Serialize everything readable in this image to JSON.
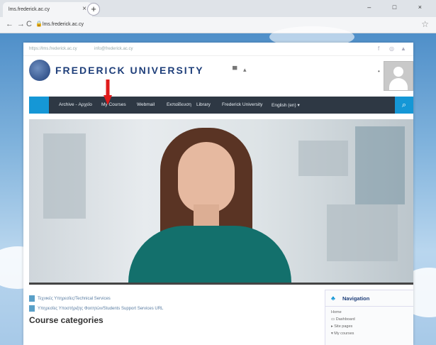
{
  "browser": {
    "tab_title": "lms.frederick.ac.cy",
    "tab_close": "×",
    "new_tab": "+",
    "window_controls": "– □ ×",
    "url": "lms.frederick.ac.cy",
    "back_icon": "arrow-left-icon",
    "reload_icon": "reload-icon"
  },
  "topbar": {
    "site_link": "https://lms.frederick.ac.cy",
    "email_link": "info@frederick.ac.cy",
    "social": [
      "f",
      "◎",
      "▲"
    ]
  },
  "header": {
    "logo_text": "FREDERICK UNIVERSITY",
    "icons": [
      "▀",
      "▴"
    ],
    "dot": "•"
  },
  "navbar": {
    "home": "",
    "items": [
      "Archive - Αρχείο",
      "My Courses",
      "Webmail",
      "Εκπαίδευση",
      "Library",
      "Frederick University",
      "English (en) ▾"
    ],
    "search_icon": "⌕"
  },
  "content": {
    "items": [
      "Τεχνικές Υπηρεσίες/Technical Services",
      "Υπηρεσίες Υποστήριξης Φοιτητών/Students Support Services URL"
    ],
    "course_categories": "Course categories"
  },
  "navigation": {
    "title": "Navigation",
    "items": [
      "Home",
      "Dashboard",
      "Site pages",
      "My courses"
    ]
  },
  "colors": {
    "accent": "#1597d6",
    "navbar_bg": "#2e3844",
    "brand": "#1f3f7a"
  }
}
